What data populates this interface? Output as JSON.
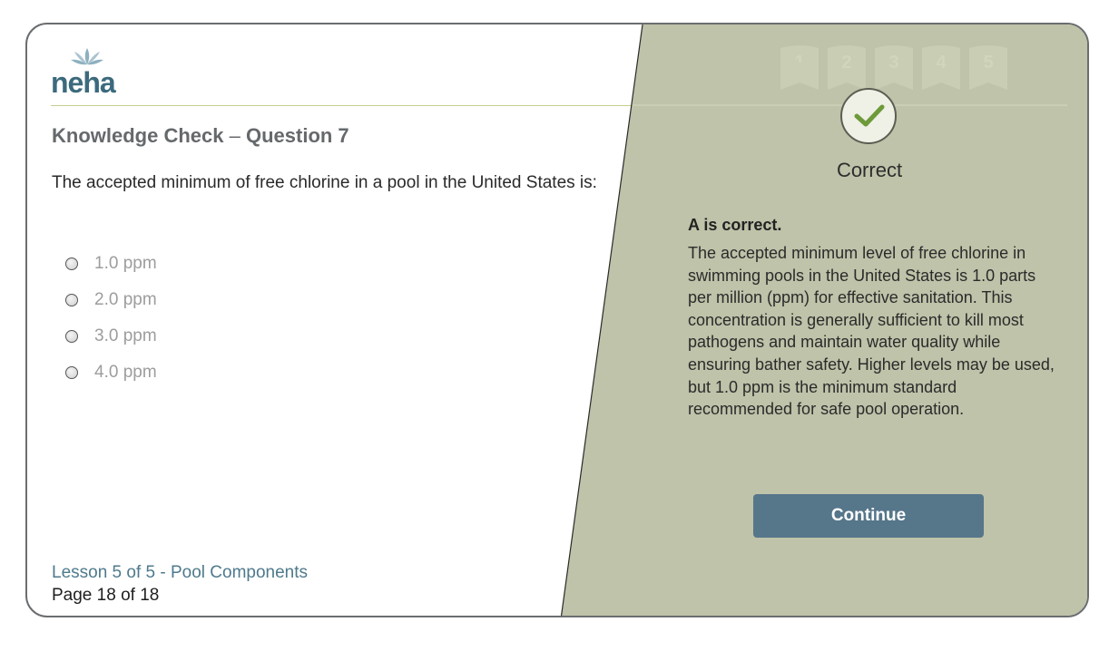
{
  "brand": {
    "logo_text": "neha"
  },
  "question": {
    "title_prefix": "Knowledge Check",
    "title_separator": "–",
    "title_suffix": "Question 7",
    "stem": "The accepted minimum of free chlorine in a pool in the United States is:",
    "options": [
      {
        "label": "1.0 ppm",
        "selected": false
      },
      {
        "label": "2.0 ppm",
        "selected": false
      },
      {
        "label": "3.0 ppm",
        "selected": false
      },
      {
        "label": "4.0 ppm",
        "selected": false
      }
    ]
  },
  "footer": {
    "lesson": "Lesson 5 of 5 - Pool Components",
    "page": "Page 18 of 18"
  },
  "progress": {
    "steps": [
      "1",
      "2",
      "3",
      "4",
      "5"
    ]
  },
  "feedback": {
    "status": "Correct",
    "headline": "A is correct.",
    "body": "The accepted minimum level of free chlorine in swimming pools in the United States is 1.0 parts per million (ppm) for effective sanitation. This concentration is generally sufficient to kill most pathogens and maintain water quality while ensuring bather safety. Higher levels may be used, but 1.0 ppm is the minimum standard recommended for safe pool operation.",
    "continue_label": "Continue"
  },
  "colors": {
    "panel": "#bec3a9",
    "button": "#56768a",
    "link": "#4e7a8c",
    "check": "#6e9a3a"
  }
}
